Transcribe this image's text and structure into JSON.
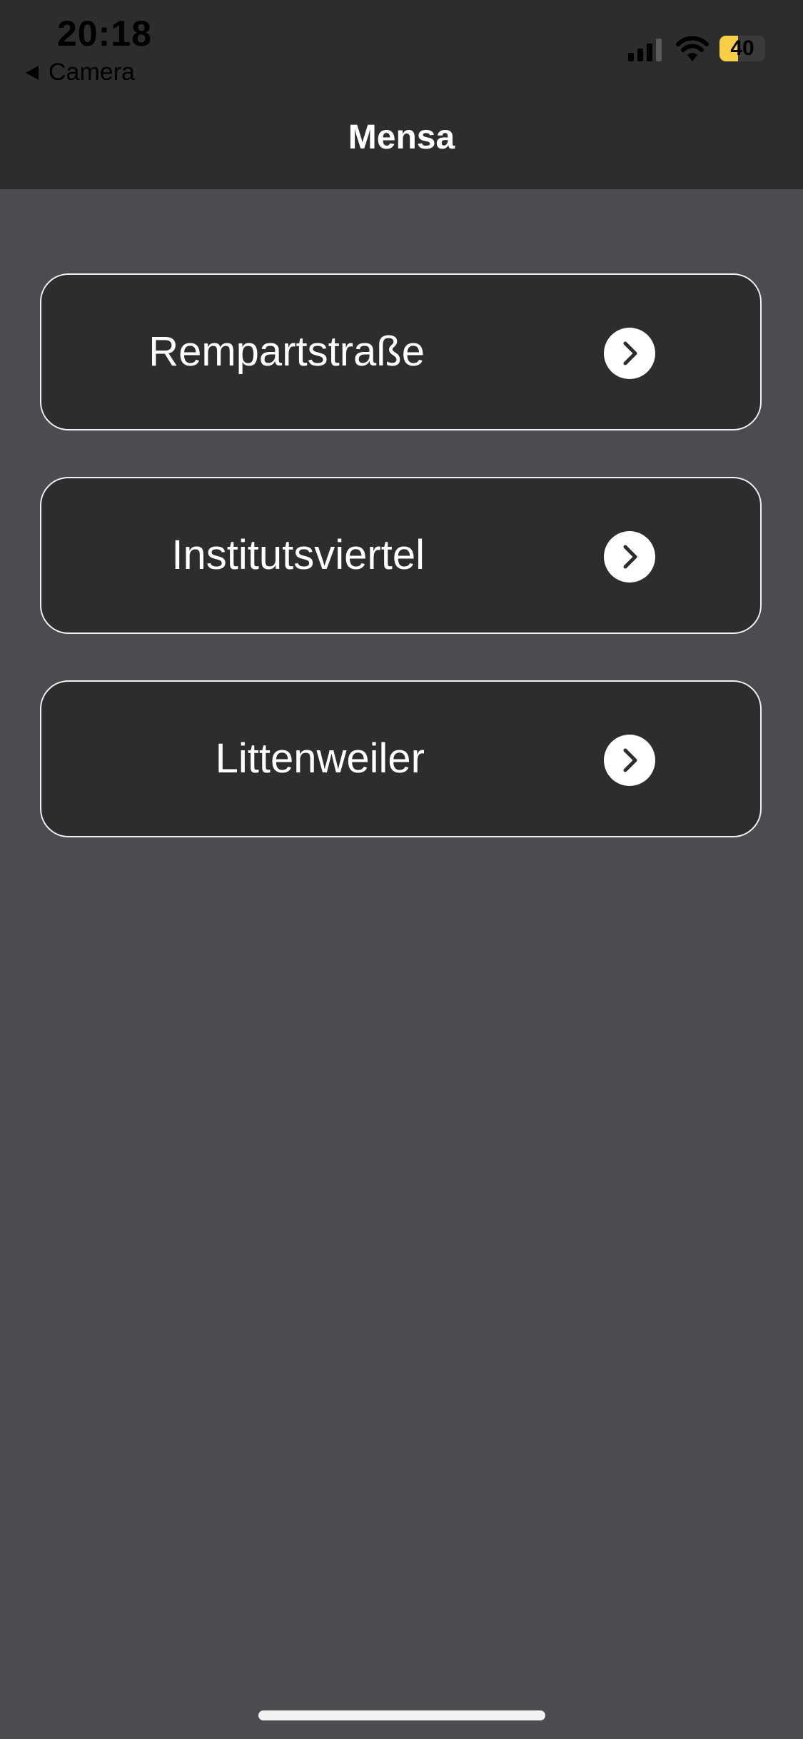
{
  "status_bar": {
    "time": "20:18",
    "back_label": "Camera",
    "battery_percent": "40",
    "battery_level": 0.4,
    "battery_color": "#f7ce46"
  },
  "nav": {
    "title": "Mensa"
  },
  "locations": [
    {
      "label": "Rempartstraße",
      "icon": "chevron-right-icon"
    },
    {
      "label": "Institutsviertel",
      "icon": "chevron-right-icon"
    },
    {
      "label": "Littenweiler",
      "icon": "chevron-right-icon"
    }
  ],
  "colors": {
    "background": "#4c4b50",
    "header": "#2d2d2f",
    "card": "#2d2d2f",
    "card_border": "#f2f2f2",
    "text": "#ffffff"
  }
}
